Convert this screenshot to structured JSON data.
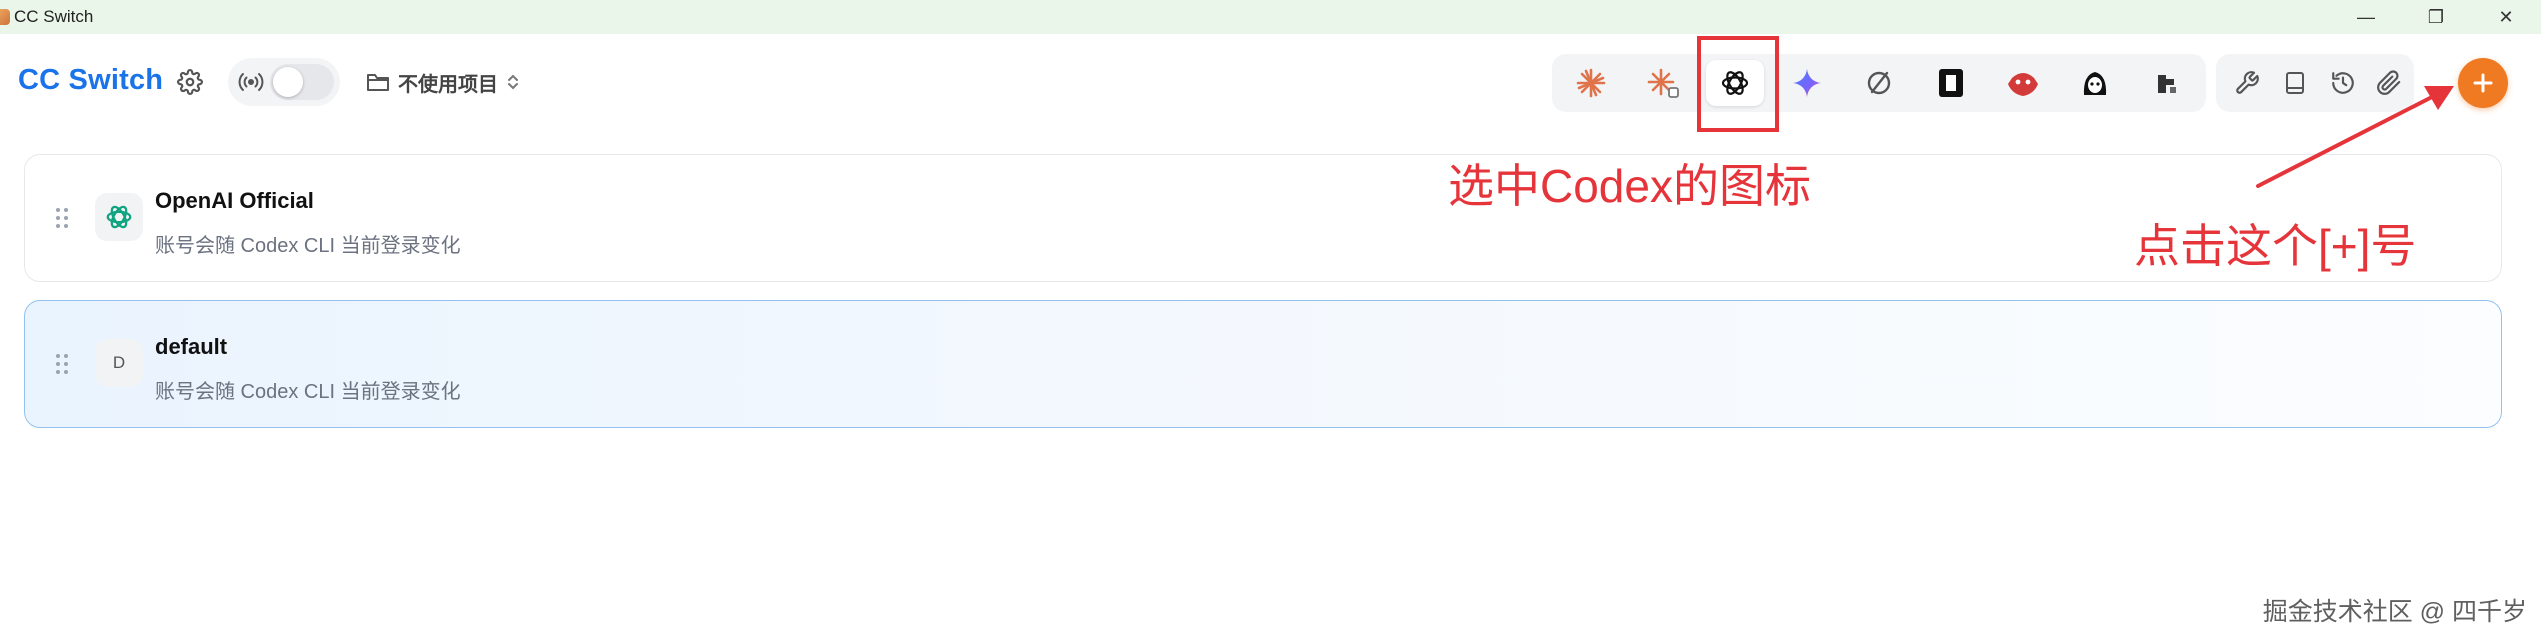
{
  "window": {
    "title": "CC Switch",
    "controls": {
      "minimize": "—",
      "restore": "❐",
      "close": "✕"
    }
  },
  "header": {
    "brand": "CC Switch",
    "project": {
      "label": "不使用项目"
    },
    "proxy_enabled": false,
    "apps": [
      {
        "name": "claude-icon"
      },
      {
        "name": "claude-alt-icon"
      },
      {
        "name": "openai-codex-icon",
        "selected": true
      },
      {
        "name": "gemini-icon"
      },
      {
        "name": "opencode-icon"
      },
      {
        "name": "bookmark-app-icon"
      },
      {
        "name": "red-robot-icon"
      },
      {
        "name": "mascot-icon"
      },
      {
        "name": "pixel-app-icon"
      }
    ],
    "tools": [
      {
        "name": "wrench-icon"
      },
      {
        "name": "book-icon"
      },
      {
        "name": "history-icon"
      },
      {
        "name": "paperclip-icon"
      }
    ],
    "add_label": "+"
  },
  "providers": [
    {
      "name": "OpenAI Official",
      "description": "账号会随 Codex CLI 当前登录变化",
      "icon": "openai-icon",
      "active": false
    },
    {
      "name": "default",
      "description": "账号会随 Codex CLI 当前登录变化",
      "icon_letter": "D",
      "active": true
    }
  ],
  "annotations": {
    "select_codex": "选中Codex的图标",
    "click_add": "点击这个[+]号"
  },
  "watermark": "掘金技术社区 @ 四千岁",
  "colors": {
    "brand": "#1a73e8",
    "accent_orange": "#f07a22",
    "annotation_red": "#e5343a",
    "active_card_border": "#93c2ee"
  }
}
